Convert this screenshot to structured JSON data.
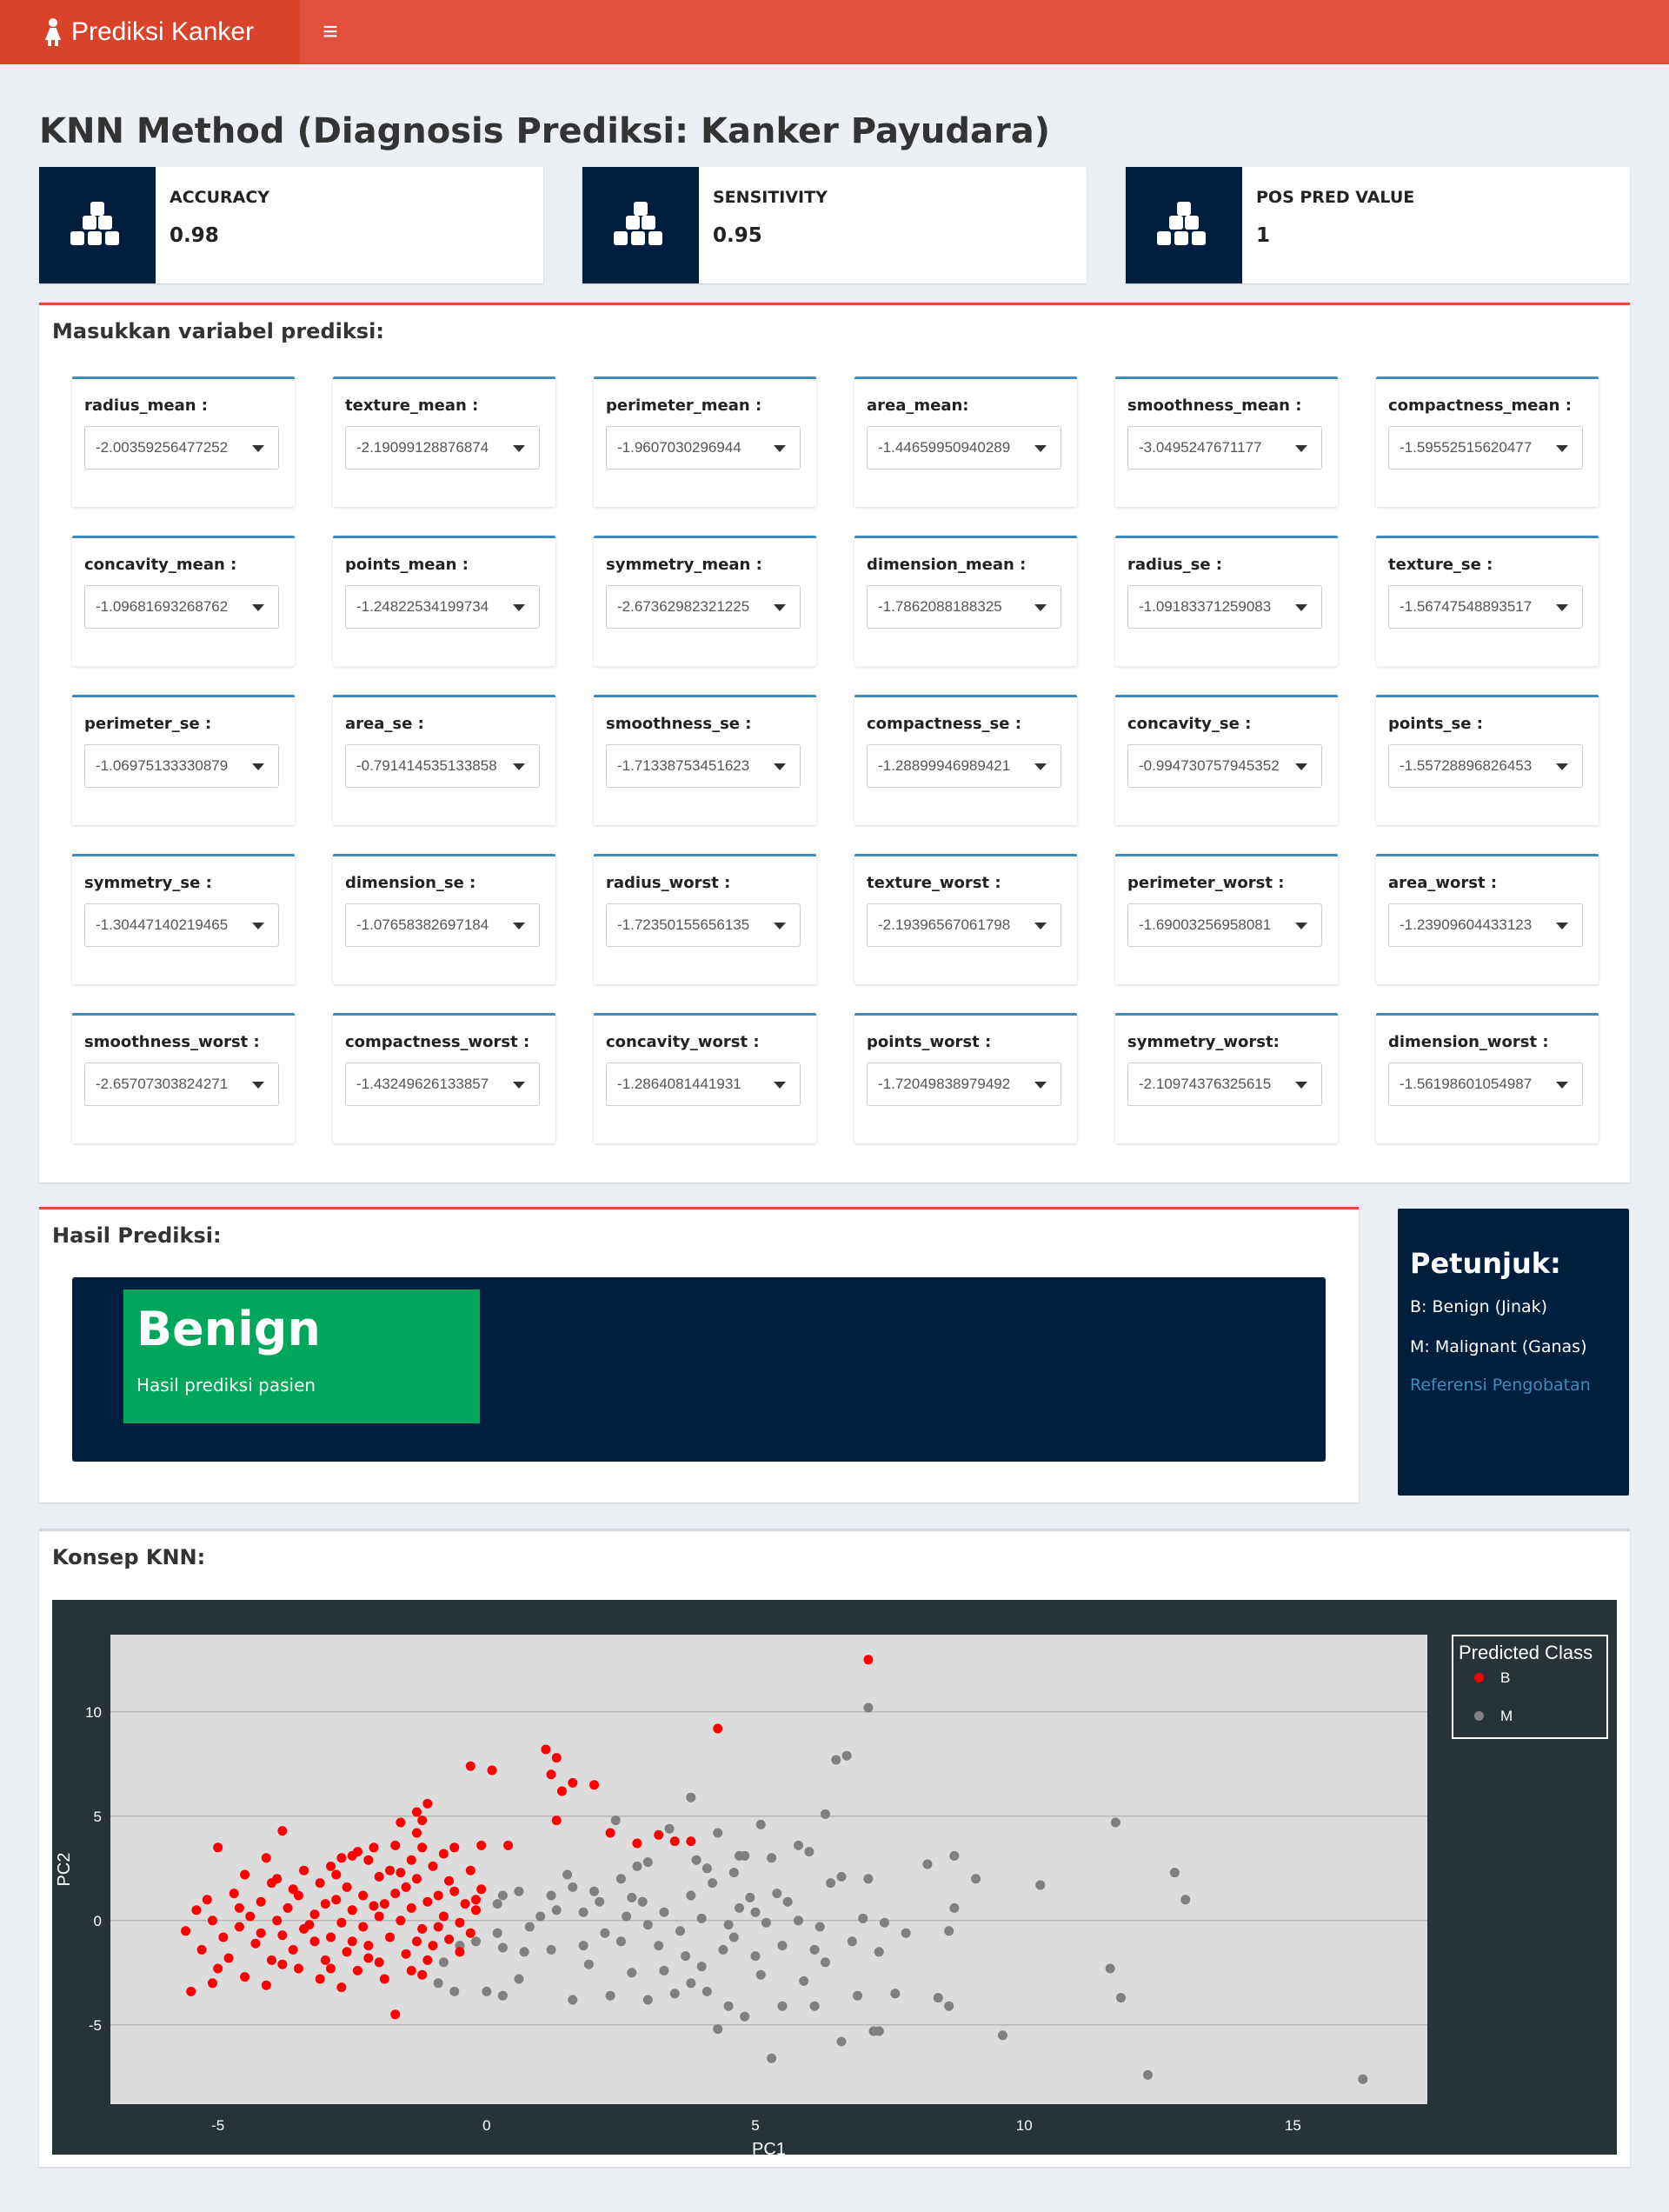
{
  "app": {
    "brand": "Prediksi Kanker"
  },
  "page": {
    "title": "KNN Method (Diagnosis Prediksi: Kanker Payudara)"
  },
  "metrics": [
    {
      "label": "ACCURACY",
      "value": "0.98"
    },
    {
      "label": "SENSITIVITY",
      "value": "0.95"
    },
    {
      "label": "POS PRED VALUE",
      "value": "1"
    }
  ],
  "input_panel": {
    "title": "Masukkan variabel prediksi:",
    "variables": [
      {
        "label": "radius_mean :",
        "value": "-2.00359256477252"
      },
      {
        "label": "texture_mean :",
        "value": "-2.19099128876874"
      },
      {
        "label": "perimeter_mean :",
        "value": "-1.9607030296944"
      },
      {
        "label": "area_mean:",
        "value": "-1.44659950940289"
      },
      {
        "label": "smoothness_mean :",
        "value": "-3.0495247671177"
      },
      {
        "label": "compactness_mean :",
        "value": "-1.59552515620477"
      },
      {
        "label": "concavity_mean :",
        "value": "-1.09681693268762"
      },
      {
        "label": "points_mean :",
        "value": "-1.24822534199734"
      },
      {
        "label": "symmetry_mean :",
        "value": "-2.67362982321225"
      },
      {
        "label": "dimension_mean :",
        "value": "-1.7862088188325"
      },
      {
        "label": "radius_se :",
        "value": "-1.09183371259083"
      },
      {
        "label": "texture_se :",
        "value": "-1.56747548893517"
      },
      {
        "label": "perimeter_se :",
        "value": "-1.06975133330879"
      },
      {
        "label": "area_se :",
        "value": "-0.791414535133858"
      },
      {
        "label": "smoothness_se :",
        "value": "-1.71338753451623"
      },
      {
        "label": "compactness_se :",
        "value": "-1.28899946989421"
      },
      {
        "label": "concavity_se :",
        "value": "-0.994730757945352"
      },
      {
        "label": "points_se :",
        "value": "-1.55728896826453"
      },
      {
        "label": "symmetry_se :",
        "value": "-1.30447140219465"
      },
      {
        "label": "dimension_se :",
        "value": "-1.07658382697184"
      },
      {
        "label": "radius_worst :",
        "value": "-1.72350155656135"
      },
      {
        "label": "texture_worst :",
        "value": "-2.19396567061798"
      },
      {
        "label": "perimeter_worst :",
        "value": "-1.69003256958081"
      },
      {
        "label": "area_worst :",
        "value": "-1.23909604433123"
      },
      {
        "label": "smoothness_worst :",
        "value": "-2.65707303824271"
      },
      {
        "label": "compactness_worst :",
        "value": "-1.43249626133857"
      },
      {
        "label": "concavity_worst :",
        "value": "-1.2864081441931"
      },
      {
        "label": "points_worst :",
        "value": "-1.72049838979492"
      },
      {
        "label": "symmetry_worst:",
        "value": "-2.10974376325615"
      },
      {
        "label": "dimension_worst :",
        "value": "-1.56198601054987"
      }
    ]
  },
  "result": {
    "title": "Hasil Prediksi:",
    "prediction": "Benign",
    "caption": "Hasil prediksi pasien"
  },
  "hint": {
    "title": "Petunjuk:",
    "line1": "B: Benign (Jinak)",
    "line2": "M: Malignant (Ganas)",
    "link": "Referensi Pengobatan"
  },
  "concept": {
    "title": "Konsep KNN:"
  },
  "colors": {
    "navbar": "#e0503c",
    "brand": "#d8432a",
    "dark": "#001f3f",
    "success": "#00a65a",
    "accent_blue": "#3c8dbc",
    "class_B": "#ff0000",
    "class_M": "#808080"
  },
  "icons": {
    "brand": "female-icon",
    "menu": "hamburger-icon",
    "metric": "cubes-icon"
  },
  "chart_data": {
    "type": "scatter",
    "xlabel": "PC1",
    "ylabel": "PC2",
    "xlim": [
      -7,
      17.5
    ],
    "ylim": [
      -8.8,
      13.7
    ],
    "xticks": [
      -5,
      0,
      5,
      10,
      15
    ],
    "yticks": [
      -5,
      0,
      5,
      10
    ],
    "legend_title": "Predicted Class",
    "legend_position": "right",
    "series": [
      {
        "name": "B",
        "color": "#ff0000",
        "points": [
          [
            7.1,
            12.5
          ],
          [
            4.3,
            9.2
          ],
          [
            1.1,
            8.2
          ],
          [
            1.3,
            7.8
          ],
          [
            -0.3,
            7.4
          ],
          [
            0.1,
            7.2
          ],
          [
            1.2,
            7.0
          ],
          [
            1.6,
            6.6
          ],
          [
            2.0,
            6.5
          ],
          [
            1.4,
            6.2
          ],
          [
            -1.1,
            5.6
          ],
          [
            -1.3,
            5.2
          ],
          [
            -1.2,
            4.8
          ],
          [
            1.3,
            4.8
          ],
          [
            -1.6,
            4.7
          ],
          [
            -3.8,
            4.3
          ],
          [
            -1.3,
            4.2
          ],
          [
            2.3,
            4.2
          ],
          [
            3.2,
            4.1
          ],
          [
            3.5,
            3.8
          ],
          [
            3.8,
            3.8
          ],
          [
            2.8,
            3.7
          ],
          [
            0.4,
            3.6
          ],
          [
            -0.1,
            3.6
          ],
          [
            -5.0,
            3.5
          ],
          [
            -1.7,
            3.6
          ],
          [
            -1.2,
            3.5
          ],
          [
            -0.6,
            3.5
          ],
          [
            -2.1,
            3.5
          ],
          [
            -2.4,
            3.3
          ],
          [
            -2.5,
            3.1
          ],
          [
            -0.8,
            3.2
          ],
          [
            -1.4,
            2.9
          ],
          [
            -4.1,
            3.0
          ],
          [
            -2.7,
            3.0
          ],
          [
            -2.2,
            2.9
          ],
          [
            -2.9,
            2.6
          ],
          [
            -3.4,
            2.4
          ],
          [
            -1.8,
            2.4
          ],
          [
            -0.3,
            2.4
          ],
          [
            -4.5,
            2.2
          ],
          [
            -3.9,
            2.0
          ],
          [
            -2.0,
            2.1
          ],
          [
            -1.3,
            2.0
          ],
          [
            -0.7,
            1.9
          ],
          [
            -4.0,
            1.8
          ],
          [
            -3.1,
            1.8
          ],
          [
            -2.6,
            1.6
          ],
          [
            -1.5,
            1.6
          ],
          [
            -0.1,
            1.5
          ],
          [
            -4.7,
            1.3
          ],
          [
            -5.2,
            1.0
          ],
          [
            -3.5,
            1.2
          ],
          [
            -2.3,
            1.2
          ],
          [
            -0.9,
            1.2
          ],
          [
            -4.2,
            0.9
          ],
          [
            -2.8,
            1.0
          ],
          [
            -1.9,
            0.8
          ],
          [
            -1.1,
            0.9
          ],
          [
            -0.4,
            0.8
          ],
          [
            -5.4,
            0.5
          ],
          [
            -3.7,
            0.6
          ],
          [
            -2.5,
            0.5
          ],
          [
            -1.4,
            0.6
          ],
          [
            -0.2,
            0.5
          ],
          [
            -4.4,
            0.2
          ],
          [
            -3.2,
            0.3
          ],
          [
            -2.0,
            0.2
          ],
          [
            -0.8,
            0.2
          ],
          [
            -5.1,
            0.0
          ],
          [
            -3.9,
            0.0
          ],
          [
            -2.7,
            -0.1
          ],
          [
            -1.6,
            0.0
          ],
          [
            -0.5,
            -0.1
          ],
          [
            -5.6,
            -0.5
          ],
          [
            -4.6,
            -0.3
          ],
          [
            -3.4,
            -0.4
          ],
          [
            -2.3,
            -0.3
          ],
          [
            -1.2,
            -0.4
          ],
          [
            -0.3,
            -0.6
          ],
          [
            -4.9,
            -0.8
          ],
          [
            -3.8,
            -0.7
          ],
          [
            -2.9,
            -0.8
          ],
          [
            -1.8,
            -0.8
          ],
          [
            -0.7,
            -0.9
          ],
          [
            -4.3,
            -1.1
          ],
          [
            -3.2,
            -1.0
          ],
          [
            -2.2,
            -1.2
          ],
          [
            -1.0,
            -1.2
          ],
          [
            -5.3,
            -1.4
          ],
          [
            -3.6,
            -1.4
          ],
          [
            -2.6,
            -1.5
          ],
          [
            -1.5,
            -1.6
          ],
          [
            -0.5,
            -1.5
          ],
          [
            -4.8,
            -1.8
          ],
          [
            -4.0,
            -1.9
          ],
          [
            -3.0,
            -1.9
          ],
          [
            -2.0,
            -2.0
          ],
          [
            -1.1,
            -1.9
          ],
          [
            -5.0,
            -2.3
          ],
          [
            -3.5,
            -2.3
          ],
          [
            -2.4,
            -2.4
          ],
          [
            -1.4,
            -2.4
          ],
          [
            -4.5,
            -2.7
          ],
          [
            -3.1,
            -2.8
          ],
          [
            -1.9,
            -2.8
          ],
          [
            -5.1,
            -3.0
          ],
          [
            -4.1,
            -3.1
          ],
          [
            -2.7,
            -3.2
          ],
          [
            -5.5,
            -3.4
          ],
          [
            -1.7,
            -4.5
          ],
          [
            -3.3,
            -0.2
          ],
          [
            -2.1,
            0.7
          ],
          [
            -1.7,
            1.3
          ],
          [
            -0.9,
            -0.3
          ],
          [
            -3.0,
            0.8
          ],
          [
            -4.2,
            -0.6
          ],
          [
            -2.5,
            -1.0
          ],
          [
            -1.3,
            -1.0
          ],
          [
            -0.6,
            1.4
          ],
          [
            -3.6,
            1.5
          ],
          [
            -2.8,
            2.2
          ],
          [
            -1.0,
            2.6
          ],
          [
            -2.2,
            -1.8
          ],
          [
            -3.8,
            -2.1
          ],
          [
            -4.6,
            0.6
          ],
          [
            -1.6,
            2.3
          ],
          [
            -0.2,
            1.0
          ],
          [
            -2.9,
            -2.3
          ],
          [
            -1.2,
            -2.6
          ]
        ]
      },
      {
        "name": "M",
        "color": "#808080",
        "points": [
          [
            7.1,
            10.2
          ],
          [
            6.5,
            7.7
          ],
          [
            6.7,
            7.9
          ],
          [
            3.8,
            5.9
          ],
          [
            6.3,
            5.1
          ],
          [
            5.1,
            4.6
          ],
          [
            2.4,
            4.8
          ],
          [
            3.4,
            4.4
          ],
          [
            4.3,
            4.2
          ],
          [
            5.8,
            3.6
          ],
          [
            6.0,
            3.3
          ],
          [
            4.8,
            3.1
          ],
          [
            5.3,
            3.0
          ],
          [
            4.7,
            3.1
          ],
          [
            3.9,
            2.9
          ],
          [
            3.0,
            2.8
          ],
          [
            2.8,
            2.6
          ],
          [
            4.1,
            2.5
          ],
          [
            4.6,
            2.3
          ],
          [
            6.6,
            2.1
          ],
          [
            8.2,
            2.7
          ],
          [
            8.7,
            3.1
          ],
          [
            9.1,
            2.0
          ],
          [
            10.3,
            1.7
          ],
          [
            11.7,
            4.7
          ],
          [
            12.8,
            2.3
          ],
          [
            13.0,
            1.0
          ],
          [
            6.4,
            1.8
          ],
          [
            7.1,
            2.0
          ],
          [
            5.4,
            1.3
          ],
          [
            4.9,
            1.1
          ],
          [
            3.8,
            1.2
          ],
          [
            2.7,
            1.1
          ],
          [
            2.0,
            1.4
          ],
          [
            1.6,
            1.6
          ],
          [
            1.2,
            1.2
          ],
          [
            0.6,
            1.4
          ],
          [
            0.3,
            1.2
          ],
          [
            0.2,
            0.8
          ],
          [
            1.8,
            0.4
          ],
          [
            2.6,
            0.2
          ],
          [
            3.3,
            0.4
          ],
          [
            4.0,
            0.1
          ],
          [
            4.5,
            -0.2
          ],
          [
            5.2,
            -0.1
          ],
          [
            5.8,
            0.0
          ],
          [
            6.2,
            -0.3
          ],
          [
            7.0,
            0.1
          ],
          [
            7.4,
            -0.1
          ],
          [
            8.7,
            0.6
          ],
          [
            8.6,
            -0.5
          ],
          [
            7.8,
            -0.6
          ],
          [
            7.3,
            -1.5
          ],
          [
            6.8,
            -1.0
          ],
          [
            6.1,
            -1.4
          ],
          [
            5.5,
            -1.2
          ],
          [
            5.0,
            -1.7
          ],
          [
            4.4,
            -1.4
          ],
          [
            3.7,
            -1.7
          ],
          [
            3.2,
            -1.2
          ],
          [
            2.5,
            -1.0
          ],
          [
            1.8,
            -1.2
          ],
          [
            1.2,
            -1.4
          ],
          [
            0.7,
            -1.5
          ],
          [
            0.3,
            -1.3
          ],
          [
            -0.2,
            -1.0
          ],
          [
            -0.5,
            -1.2
          ],
          [
            -0.8,
            -2.0
          ],
          [
            -0.9,
            -3.0
          ],
          [
            -0.6,
            -3.4
          ],
          [
            0.0,
            -3.4
          ],
          [
            0.3,
            -3.6
          ],
          [
            1.6,
            -3.8
          ],
          [
            2.3,
            -3.6
          ],
          [
            3.0,
            -3.8
          ],
          [
            3.5,
            -3.5
          ],
          [
            4.1,
            -3.4
          ],
          [
            4.5,
            -4.1
          ],
          [
            4.8,
            -4.6
          ],
          [
            5.5,
            -4.1
          ],
          [
            6.1,
            -4.1
          ],
          [
            6.9,
            -3.6
          ],
          [
            7.6,
            -3.5
          ],
          [
            8.6,
            -4.1
          ],
          [
            8.4,
            -3.7
          ],
          [
            7.2,
            -5.3
          ],
          [
            7.3,
            -5.3
          ],
          [
            6.6,
            -5.8
          ],
          [
            5.3,
            -6.6
          ],
          [
            4.3,
            -5.2
          ],
          [
            9.6,
            -5.5
          ],
          [
            11.6,
            -2.3
          ],
          [
            11.8,
            -3.7
          ],
          [
            12.3,
            -7.4
          ],
          [
            16.3,
            -7.6
          ],
          [
            1.3,
            0.5
          ],
          [
            2.2,
            -0.6
          ],
          [
            2.9,
            0.9
          ],
          [
            3.6,
            -0.5
          ],
          [
            4.2,
            1.8
          ],
          [
            4.7,
            0.6
          ],
          [
            5.6,
            0.9
          ],
          [
            1.5,
            2.2
          ],
          [
            2.5,
            2.0
          ],
          [
            0.8,
            -0.3
          ],
          [
            0.2,
            -0.6
          ],
          [
            1.0,
            0.2
          ],
          [
            3.3,
            -2.4
          ],
          [
            2.7,
            -2.5
          ],
          [
            4.0,
            -2.2
          ],
          [
            5.1,
            -2.6
          ],
          [
            6.3,
            -2.0
          ],
          [
            1.9,
            -2.1
          ],
          [
            3.8,
            -3.0
          ],
          [
            0.6,
            -2.8
          ],
          [
            5.9,
            -2.9
          ],
          [
            4.6,
            -0.8
          ],
          [
            3.0,
            -0.2
          ],
          [
            2.1,
            0.9
          ],
          [
            5.0,
            0.4
          ]
        ]
      }
    ]
  }
}
